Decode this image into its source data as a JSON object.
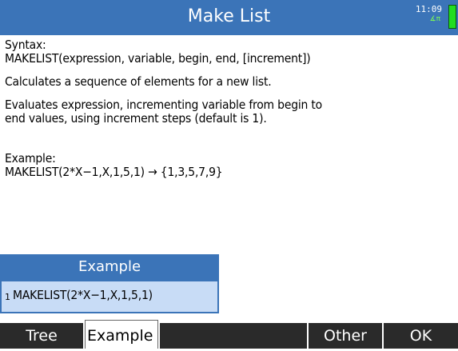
{
  "header": {
    "title": "Make List",
    "clock": "11:09",
    "angle_indicator": "∡π"
  },
  "help": {
    "syntax_label": "Syntax:",
    "syntax": "MAKELIST(expression, variable, begin, end, [increment])",
    "description": "Calculates a sequence of elements for a new list.",
    "details_line1": "Evaluates expression, incrementing variable from begin to",
    "details_line2": "end values, using increment steps (default is 1).",
    "example_label": "Example:",
    "example": "MAKELIST(2*X−1,X,1,5,1) → {1,3,5,7,9}"
  },
  "example_panel": {
    "header": "Example",
    "items": [
      {
        "number": "1",
        "text": "MAKELIST(2*X−1,X,1,5,1)"
      }
    ]
  },
  "softkeys": {
    "tree": "Tree",
    "example": "Example",
    "blank": "",
    "other": "Other",
    "ok": "OK"
  },
  "colors": {
    "title_bar": "#3b74b8",
    "selection": "#c8dcf6",
    "softkey": "#2a2a2a",
    "battery": "#22dd22"
  }
}
